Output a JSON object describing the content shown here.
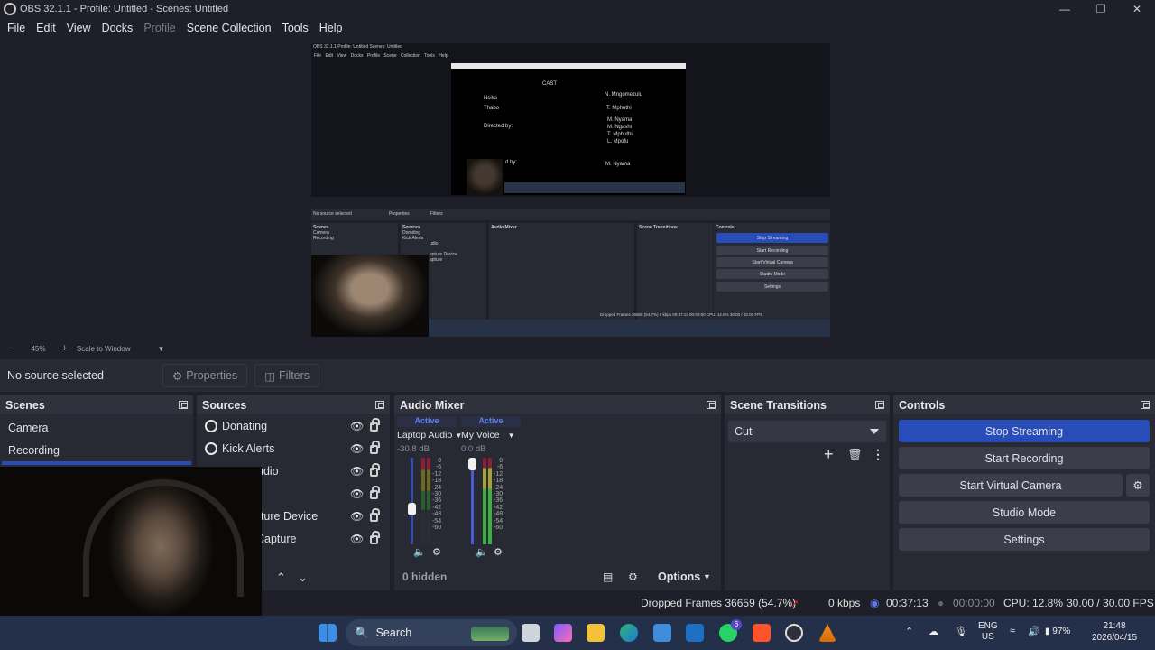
{
  "window": {
    "title": "OBS 32.1.1 - Profile: Untitled - Scenes: Untitled"
  },
  "menu": [
    "File",
    "Edit",
    "View",
    "Docks",
    "Profile",
    "Scene Collection",
    "Tools",
    "Help"
  ],
  "preview": {
    "inner_title": "OBS 32.1.1   Profile: Untitled   Scenes: Untitled",
    "inner_menu": "File Edit View Docks Profile Scene Collection Tools Help",
    "credits": {
      "heading": "CAST",
      "rows": [
        {
          "left": "Nsika",
          "right": "N. Mngomezulu"
        },
        {
          "left": "Thabo",
          "right": "T. Mphuthi"
        },
        {
          "left": "Directed by:",
          "right": "M. Nyama\nM. Ngashi\nT. Mphuthi\nL. Mpofu"
        },
        {
          "left": "d by:",
          "right": "M. Nyama"
        }
      ]
    },
    "inner_nosource": "No source selected",
    "inner_properties": "Properties",
    "inner_filters": "Filters",
    "inner_docks": [
      "Scenes",
      "Sources",
      "Audio Mixer",
      "Scene Transitions",
      "Controls"
    ],
    "inner_scenes": [
      "Camera",
      "Recording"
    ],
    "inner_sources": [
      "Donating",
      "Kick Alerts",
      "udio",
      "apture Device",
      "apture"
    ],
    "inner_controls": [
      "Stop Streaming",
      "Start Recording",
      "Start Virtual Camera",
      "Studio Mode",
      "Settings"
    ],
    "inner_status": "Dropped Frames 36659 (54.7%)   0 kbps   00:37:13   00:00:00   CPU: 12.8%   30.00 / 30.00 FPS"
  },
  "zoom": {
    "level": "45%",
    "scale_label": "Scale to Window"
  },
  "source_toolbar": {
    "no_source": "No source selected",
    "properties": "Properties",
    "filters": "Filters"
  },
  "scenes": {
    "title": "Scenes",
    "items": [
      "Camera",
      "Recording"
    ]
  },
  "sources": {
    "title": "Sources",
    "items": [
      {
        "label": "Donating"
      },
      {
        "label": "Kick Alerts"
      },
      {
        "label": "udio"
      },
      {
        "label": ""
      },
      {
        "label": "pture Device"
      },
      {
        "label": "Capture"
      }
    ]
  },
  "mixer": {
    "title": "Audio Mixer",
    "channels": [
      {
        "status": "Active",
        "name": "Laptop Audio",
        "db": "-30.8 dB",
        "volume_fraction": 0.55
      },
      {
        "status": "Active",
        "name": "My Voice",
        "db": "0.0 dB",
        "volume_fraction": 1.0
      }
    ],
    "scale": [
      "0",
      "-6",
      "-12",
      "-18",
      "-24",
      "-30",
      "-36",
      "-42",
      "-48",
      "-54",
      "-60"
    ],
    "hidden": "0 hidden",
    "options": "Options"
  },
  "transitions": {
    "title": "Scene Transitions",
    "selected": "Cut"
  },
  "controls": {
    "title": "Controls",
    "stop_streaming": "Stop Streaming",
    "start_recording": "Start Recording",
    "start_virtual_camera": "Start Virtual Camera",
    "studio_mode": "Studio Mode",
    "settings": "Settings"
  },
  "status": {
    "dropped": "Dropped Frames 36659 (54.7%)",
    "kbps": "0 kbps",
    "stream_time": "00:37:13",
    "record_time": "00:00:00",
    "cpu": "CPU: 12.8%",
    "fps": "30.00 / 30.00 FPS"
  },
  "taskbar": {
    "search": "Search",
    "lang_top": "ENG",
    "lang_bottom": "US",
    "battery": "97%",
    "time": "21:48",
    "date": "2026/04/15",
    "whatsapp_badge": "6"
  },
  "colors": {
    "accent": "#284cb8",
    "panel": "#272a33",
    "background": "#1e1f29",
    "active_text": "#5c7ef0"
  }
}
